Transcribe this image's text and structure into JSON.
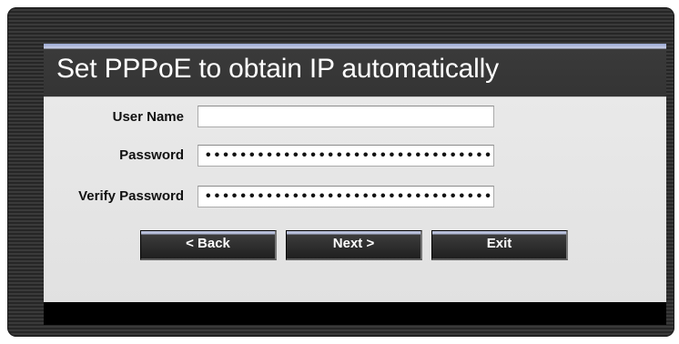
{
  "dialog": {
    "title": "Set PPPoE to obtain IP automatically"
  },
  "form": {
    "user_name": {
      "label": "User Name",
      "value": ""
    },
    "password": {
      "label": "Password",
      "value": "••••••••••••••••••••••••••••••••••"
    },
    "verify_password": {
      "label": "Verify Password",
      "value": "••••••••••••••••••••••••••••••••••"
    }
  },
  "buttons": {
    "back": "< Back",
    "next": "Next >",
    "exit": "Exit"
  }
}
